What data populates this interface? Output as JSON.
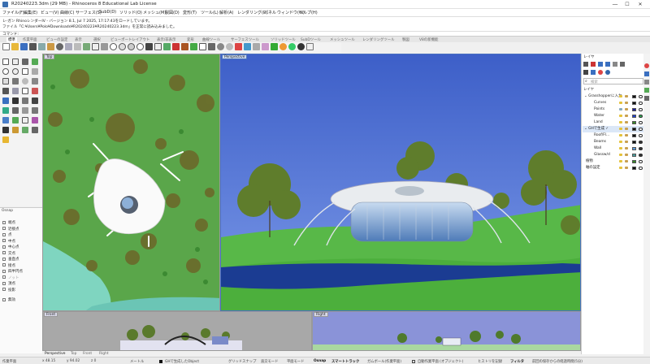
{
  "window": {
    "title": "R20240223.3dm (29 MB) - Rhinoceros 8 Educational Lab License",
    "controls": {
      "minimize": "—",
      "maximize": "☐",
      "close": "✕"
    }
  },
  "menu": [
    "ファイル(F)",
    "編集(E)",
    "ビュー(V)",
    "曲線(C)",
    "サーフェス(S)",
    "SubD(D)",
    "ソリッド(O)",
    "メッシュ(M)",
    "製図(D)",
    "変形(T)",
    "ツール(L)",
    "解析(A)",
    "レンダリング(R)",
    "パネル",
    "ウィンドウ(W)",
    "ヘルプ(H)"
  ],
  "command_history": [
    "レ-ガン RhinoレンダーIV - バージョン 8.1, Jul 7 2025, 17:17:43をロードしています。",
    "ファイル「C:¥Users¥Polo¥Downloads¥R20240223¥R20240223.3dm」を正常に読み込みました。"
  ],
  "command_prompt": "コマンド:",
  "ribbon_tabs": [
    "標準",
    "作業平面",
    "ビューの設定",
    "表示",
    "選択",
    "ビューポートレイアウト",
    "表示/非表示",
    "変形",
    "曲線ツール",
    "サーフェスツール",
    "ソリッドツール",
    "SubDツール",
    "メッシュツール",
    "レンダリングツール",
    "製図",
    "V8の新機能"
  ],
  "active_ribbon_tab": "標準",
  "viewports": {
    "top": "Top",
    "perspective": "Perspective",
    "front": "Front",
    "right": "Right"
  },
  "viewport_tabs": [
    "Perspective",
    "Top",
    "Front",
    "Right"
  ],
  "osnap": {
    "header": "Osnap",
    "items": [
      "端点",
      "近接点",
      "点",
      "中点",
      "中心点",
      "交点",
      "垂直点",
      "接点",
      "四半円点",
      "ノット",
      "頂点",
      "投影"
    ],
    "disable": "無効"
  },
  "layers_panel": {
    "title": "レイヤ",
    "search_placeholder": "検索",
    "column": "レイヤ",
    "layers": [
      {
        "name": "Grasshopperに入力",
        "color": "#111111",
        "level": 0,
        "bold": false,
        "expanded": true
      },
      {
        "name": "Curves",
        "color": "#111111",
        "level": 1
      },
      {
        "name": "Points",
        "color": "#1a1a9a",
        "level": 1
      },
      {
        "name": "Water",
        "color": "#1e3fd0",
        "level": 1
      },
      {
        "name": "Land",
        "color": "#3a8a2a",
        "level": 1
      },
      {
        "name": "GHで生成",
        "color": "#111111",
        "level": 0,
        "expanded": true,
        "current": true
      },
      {
        "name": "Roof/Fl...",
        "color": "#111111",
        "level": 1
      },
      {
        "name": "Beams",
        "color": "#111111",
        "level": 1
      },
      {
        "name": "Wall",
        "color": "#5a9ad8",
        "level": 1
      },
      {
        "name": "Glassw/d",
        "color": "#4aa0a0",
        "level": 1
      },
      {
        "name": "植物",
        "color": "#3a8a2a",
        "level": 0
      },
      {
        "name": "軸の設定",
        "color": "#111111",
        "level": 0
      }
    ]
  },
  "status_bar": {
    "plane": "作業平面",
    "x": "x 48.15",
    "y": "y 94.02",
    "z": "z 0",
    "unit": "メートル",
    "layer": "GHで生成したObject",
    "grid_snap": "グリッドスナップ",
    "ortho": "直交モード",
    "planar": "平面モード",
    "osnap": "Osnap",
    "smarttrack": "スマートトラック",
    "gumball": "ガムボール(作業平面)",
    "autocplane": "自動作業平面 (オブジェクト)",
    "history": "ヒストリを記録",
    "filter": "フィルタ",
    "message": "前回の保存からの経過時間(5分)"
  }
}
